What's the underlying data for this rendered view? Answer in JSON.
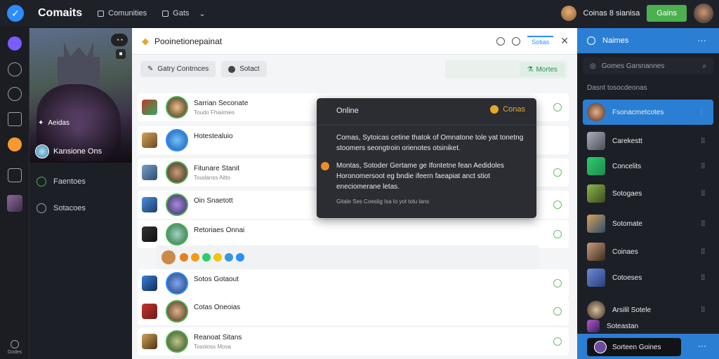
{
  "topbar": {
    "title": "Comaits",
    "nav1": "Comunities",
    "nav2": "Gats",
    "user_text": "Coinas 8 sianisa",
    "button": "Gains"
  },
  "rail": {
    "footer": "Godes"
  },
  "left_panel": {
    "hero_tag": "Aeidas",
    "hero_name": "Kansione Ons",
    "menu": [
      "Faentoes",
      "Sotacoes"
    ]
  },
  "main": {
    "title": "Pooinetionepainat",
    "header_tab": "Sotias",
    "toolbar": {
      "btn1": "Gatry Contrnces",
      "btn2": "Sotact"
    },
    "search_btn": "Mortes",
    "rows": [
      {
        "name": "Sarrian Seconate",
        "sub": "Toudo Fhiaimies"
      },
      {
        "name": "Hotestealuio",
        "sub": ""
      },
      {
        "name": "Fitunare Stanit",
        "sub": "Toudanss Aitto"
      },
      {
        "name": "Oin Snaetott",
        "sub": ""
      },
      {
        "name": "Retoriaes Onnai",
        "sub": ""
      },
      {
        "name": "Sotos Gotaout",
        "sub": ""
      },
      {
        "name": "Cotas Oneoias",
        "sub": ""
      },
      {
        "name": "Reanoat Sitans",
        "sub": "Tosoioss Mosa"
      }
    ]
  },
  "popup": {
    "title": "Online",
    "badge": "Conas",
    "p1": "Comas, Sytoicas cetine thatok of Omnatone tole yat tonetng stoomers seongtroin orienotes otsiniket.",
    "p2": "Montas, Sotoder Gertame ge Ifontetne fean Aedidoles Horonomersoot eg bndie ifeern faeapiat anct stiot eneciomerane letas.",
    "footer": "Gitale Ses Coeslig Isa lo yot tolu lans"
  },
  "right_panel": {
    "header": "Naimes",
    "search": "Gomes Garsnannes",
    "section": "Dasnt tosocdeonas",
    "items": [
      "Fsonacmetcotes",
      "Carekestt",
      "Concelits",
      "Sotogaes",
      "Sotomate",
      "Coinaes",
      "Cotoeses",
      "Arsilil Sotele",
      "Soteastan"
    ],
    "footer": "Sorteen Goines"
  },
  "colors": {
    "accent_blue": "#2a7fd4",
    "green": "#4caf50",
    "orange": "#e6a72a"
  }
}
